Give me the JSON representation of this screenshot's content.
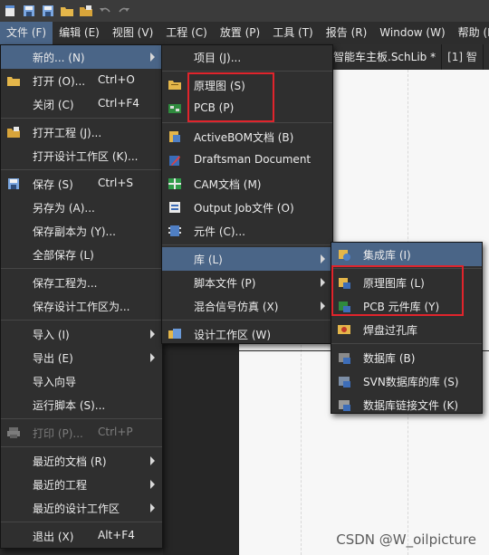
{
  "menubar": {
    "items": [
      {
        "label": "文件 (F)",
        "active": true
      },
      {
        "label": "编辑 (E)"
      },
      {
        "label": "视图 (V)"
      },
      {
        "label": "工程 (C)"
      },
      {
        "label": "放置 (P)"
      },
      {
        "label": "工具 (T)"
      },
      {
        "label": "报告 (R)"
      },
      {
        "label": "Window (W)"
      },
      {
        "label": "帮助 (H)"
      }
    ]
  },
  "doc_tabs": [
    {
      "label": "智能车主板.SchLib *"
    },
    {
      "label": "[1] 智"
    }
  ],
  "file_menu": {
    "new": {
      "label": "新的... (N)"
    },
    "open": {
      "label": "打开 (O)...",
      "shortcut": "Ctrl+O"
    },
    "close": {
      "label": "关闭 (C)",
      "shortcut": "Ctrl+F4"
    },
    "open_project": {
      "label": "打开工程 (J)..."
    },
    "open_workspace": {
      "label": "打开设计工作区 (K)..."
    },
    "save": {
      "label": "保存 (S)",
      "shortcut": "Ctrl+S"
    },
    "save_as": {
      "label": "另存为 (A)..."
    },
    "save_copy_as": {
      "label": "保存副本为 (Y)..."
    },
    "save_all": {
      "label": "全部保存 (L)"
    },
    "save_project_as": {
      "label": "保存工程为..."
    },
    "save_workspace_as": {
      "label": "保存设计工作区为..."
    },
    "import": {
      "label": "导入 (I)"
    },
    "export": {
      "label": "导出 (E)"
    },
    "import_wizard": {
      "label": "导入向导"
    },
    "run_script": {
      "label": "运行脚本 (S)..."
    },
    "print": {
      "label": "打印 (P)...",
      "shortcut": "Ctrl+P"
    },
    "recent_docs": {
      "label": "最近的文档 (R)"
    },
    "recent_projects": {
      "label": "最近的工程"
    },
    "recent_workspaces": {
      "label": "最近的设计工作区"
    },
    "exit": {
      "label": "退出 (X)",
      "shortcut": "Alt+F4"
    }
  },
  "new_menu": {
    "project": {
      "label": "项目 (J)..."
    },
    "schematic": {
      "label": "原理图 (S)"
    },
    "pcb": {
      "label": "PCB (P)"
    },
    "activebom": {
      "label": "ActiveBOM文档 (B)"
    },
    "draftsman": {
      "label": "Draftsman Document"
    },
    "cam": {
      "label": "CAM文档 (M)"
    },
    "outjob": {
      "label": "Output Job文件 (O)"
    },
    "component": {
      "label": "元件 (C)..."
    },
    "library": {
      "label": "库 (L)"
    },
    "script_file": {
      "label": "脚本文件 (P)"
    },
    "mixed_sim": {
      "label": "混合信号仿真 (X)"
    },
    "workspace": {
      "label": "设计工作区 (W)"
    }
  },
  "library_menu": {
    "integrated": {
      "label": "集成库 (I)"
    },
    "schlib": {
      "label": "原理图库 (L)"
    },
    "pcblib": {
      "label": "PCB 元件库 (Y)"
    },
    "padvia": {
      "label": "焊盘过孔库"
    },
    "database": {
      "label": "数据库 (B)"
    },
    "svn_db": {
      "label": "SVN数据库的库 (S)"
    },
    "db_link": {
      "label": "数据库链接文件 (K)"
    }
  },
  "watermark": "CSDN @W_oilpicture",
  "colors": {
    "menu_bg": "#2f2f2f",
    "highlight": "#4a6587",
    "annotation_red": "#e0242c"
  }
}
